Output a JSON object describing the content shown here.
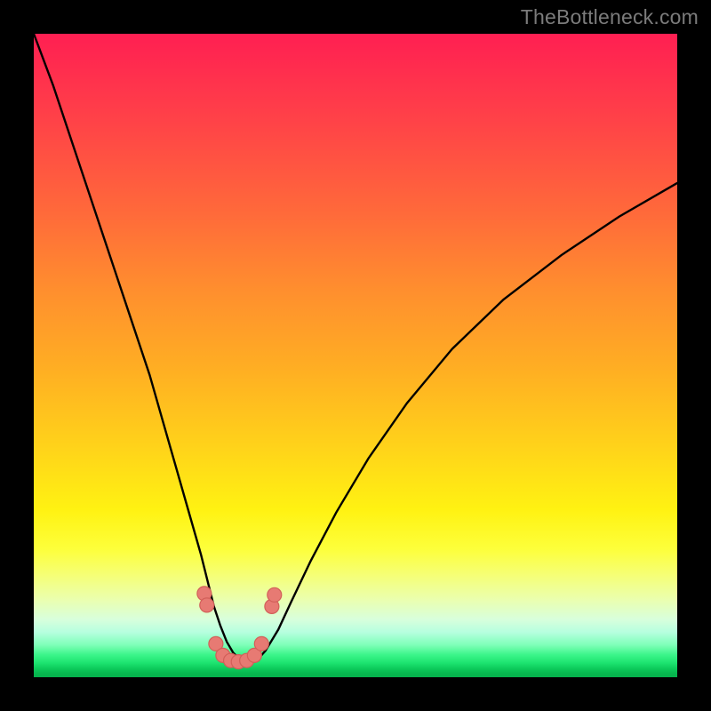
{
  "watermark": "TheBottleneck.com",
  "colors": {
    "background": "#000000",
    "curve": "#000000",
    "dots": "#e77a73",
    "gradient_top": "#ff1f52",
    "gradient_bottom": "#06b24d"
  },
  "chart_data": {
    "type": "line",
    "title": "",
    "xlabel": "",
    "ylabel": "",
    "xlim": [
      0,
      100
    ],
    "ylim": [
      0,
      100
    ],
    "series": [
      {
        "name": "bottleneck-curve",
        "x": [
          0,
          3,
          6,
          9,
          12,
          15,
          18,
          20,
          22,
          24,
          26,
          27,
          28,
          29,
          30,
          31,
          32,
          33,
          34,
          35,
          36,
          38,
          40,
          43,
          47,
          52,
          58,
          65,
          73,
          82,
          91,
          100
        ],
        "y": [
          100,
          92,
          83,
          74,
          65,
          56,
          47,
          40,
          33,
          26,
          19,
          15,
          11,
          8,
          5.5,
          3.8,
          2.8,
          2.4,
          2.5,
          3.0,
          4.1,
          7.4,
          11.7,
          18.0,
          25.6,
          34.0,
          42.6,
          51.0,
          58.7,
          65.6,
          71.6,
          76.8
        ]
      }
    ],
    "markers": [
      {
        "x": 26.5,
        "y": 13.0
      },
      {
        "x": 26.9,
        "y": 11.2
      },
      {
        "x": 28.3,
        "y": 5.2
      },
      {
        "x": 29.4,
        "y": 3.4
      },
      {
        "x": 30.6,
        "y": 2.6
      },
      {
        "x": 31.8,
        "y": 2.4
      },
      {
        "x": 33.1,
        "y": 2.6
      },
      {
        "x": 34.3,
        "y": 3.4
      },
      {
        "x": 35.4,
        "y": 5.2
      },
      {
        "x": 37.0,
        "y": 11.0
      },
      {
        "x": 37.4,
        "y": 12.8
      }
    ]
  }
}
